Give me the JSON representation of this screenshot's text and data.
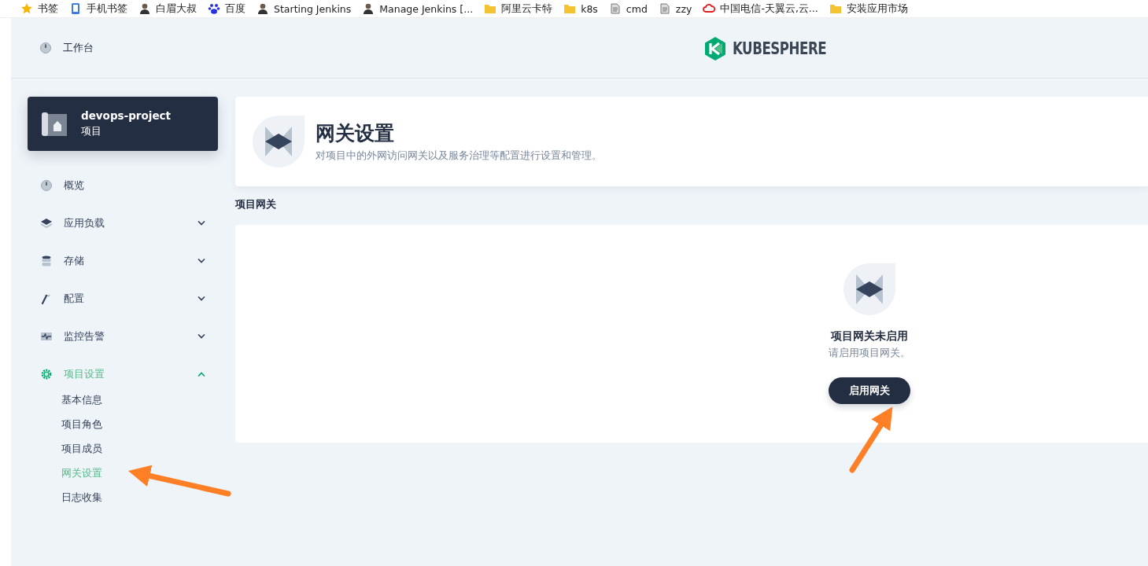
{
  "bookmarks": [
    {
      "label": "书签",
      "kind": "star"
    },
    {
      "label": "手机书签",
      "kind": "phone"
    },
    {
      "label": "白眉大叔",
      "kind": "person"
    },
    {
      "label": "百度",
      "kind": "paw"
    },
    {
      "label": "Starting Jenkins",
      "kind": "person"
    },
    {
      "label": "Manage Jenkins [...",
      "kind": "person"
    },
    {
      "label": "阿里云卡特",
      "kind": "folder"
    },
    {
      "label": "k8s",
      "kind": "folder"
    },
    {
      "label": "cmd",
      "kind": "document"
    },
    {
      "label": "zzy",
      "kind": "document"
    },
    {
      "label": "中国电信-天翼云,云...",
      "kind": "cloud"
    },
    {
      "label": "安装应用市场",
      "kind": "folder"
    }
  ],
  "header": {
    "workbench": "工作台",
    "logo": "KUBESPHERE"
  },
  "project": {
    "name": "devops-project",
    "type": "项目"
  },
  "nav": [
    {
      "label": "概览",
      "kind": "dashboard",
      "selected": false
    },
    {
      "label": "应用负载",
      "kind": "layers",
      "selected": false,
      "expanded": false
    },
    {
      "label": "存储",
      "kind": "database",
      "selected": false,
      "expanded": false
    },
    {
      "label": "配置",
      "kind": "hammer",
      "selected": false,
      "expanded": false
    },
    {
      "label": "监控告警",
      "kind": "monitor",
      "selected": false,
      "expanded": false
    },
    {
      "label": "项目设置",
      "kind": "gear",
      "selected": true,
      "expanded": true,
      "children": [
        {
          "label": "基本信息",
          "selected": false
        },
        {
          "label": "项目角色",
          "selected": false
        },
        {
          "label": "项目成员",
          "selected": false
        },
        {
          "label": "网关设置",
          "selected": true
        },
        {
          "label": "日志收集",
          "selected": false
        }
      ]
    }
  ],
  "page": {
    "title": "网关设置",
    "description": "对项目中的外网访问网关以及服务治理等配置进行设置和管理。"
  },
  "section": {
    "title": "项目网关",
    "empty_title": "项目网关未启用",
    "empty_hint": "请启用项目网关。",
    "button": "启用网关"
  }
}
